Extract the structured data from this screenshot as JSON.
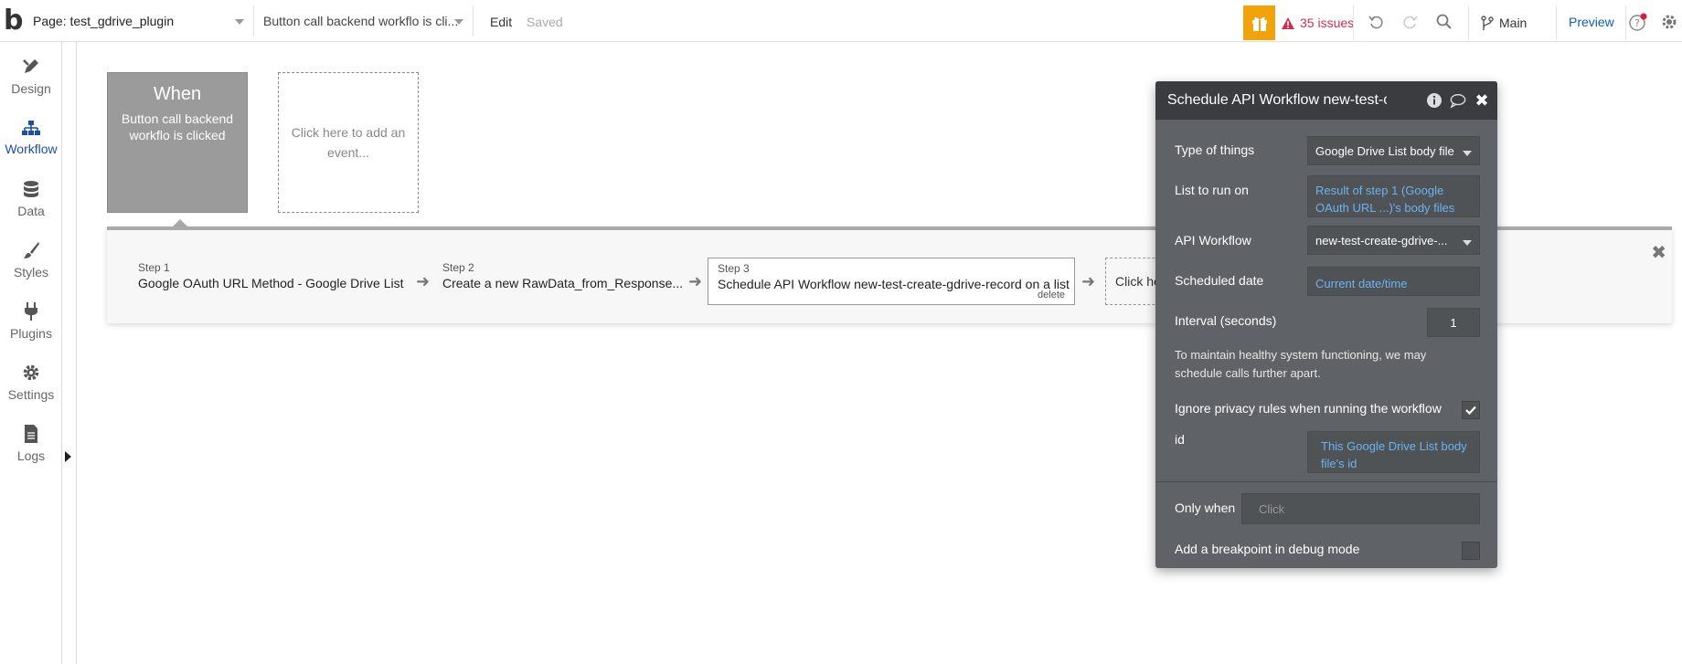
{
  "topbar": {
    "logo": "b",
    "page_select": "Page: test_gdrive_plugin",
    "workflow_select": "Button call backend workflo is cli...",
    "edit_label": "Edit",
    "saved_label": "Saved",
    "issues_label": "35 issues",
    "branch_label": "Main",
    "preview_label": "Preview"
  },
  "sidebar": {
    "items": [
      {
        "label": "Design"
      },
      {
        "label": "Workflow"
      },
      {
        "label": "Data"
      },
      {
        "label": "Styles"
      },
      {
        "label": "Plugins"
      },
      {
        "label": "Settings"
      },
      {
        "label": "Logs"
      }
    ],
    "active": "Workflow"
  },
  "canvas": {
    "event": {
      "when": "When",
      "description": "Button call backend workflo is clicked"
    },
    "add_event": "Click here to add an event...",
    "steps": [
      {
        "label": "Step 1",
        "title": "Google OAuth URL Method - Google Drive List"
      },
      {
        "label": "Step 2",
        "title": "Create a new RawData_from_Response..."
      },
      {
        "label": "Step 3",
        "title": "Schedule API Workflow new-test-create-gdrive-record on a list",
        "delete": "delete"
      }
    ],
    "add_step": "Click here to add an action..."
  },
  "panel": {
    "title": "Schedule API Workflow new-test-create-gdrive-record on a list",
    "type_of_things": {
      "label": "Type of things",
      "value": "Google Drive List body file"
    },
    "list_to_run_on": {
      "label": "List to run on",
      "value": "Result of step 1 (Google OAuth URL ...)'s body files"
    },
    "api_workflow": {
      "label": "API Workflow",
      "value": "new-test-create-gdrive-..."
    },
    "scheduled_date": {
      "label": "Scheduled date",
      "value": "Current date/time"
    },
    "interval": {
      "label": "Interval (seconds)",
      "value": "1"
    },
    "note": "To maintain healthy system functioning, we may schedule calls further apart.",
    "ignore_privacy": {
      "label": "Ignore privacy rules when running the workflow",
      "checked": true
    },
    "id_field": {
      "label": "id",
      "value": "This Google Drive List body file's id"
    },
    "only_when": {
      "label": "Only when",
      "placeholder": "Click"
    },
    "breakpoint": {
      "label": "Add a breakpoint in debug mode",
      "checked": false
    }
  },
  "colors": {
    "accent": "#1a4fa8",
    "gift": "#f0a30a",
    "issues": "#d0304d",
    "link": "#6ab3f2",
    "panel_bg": "#5f6266"
  }
}
